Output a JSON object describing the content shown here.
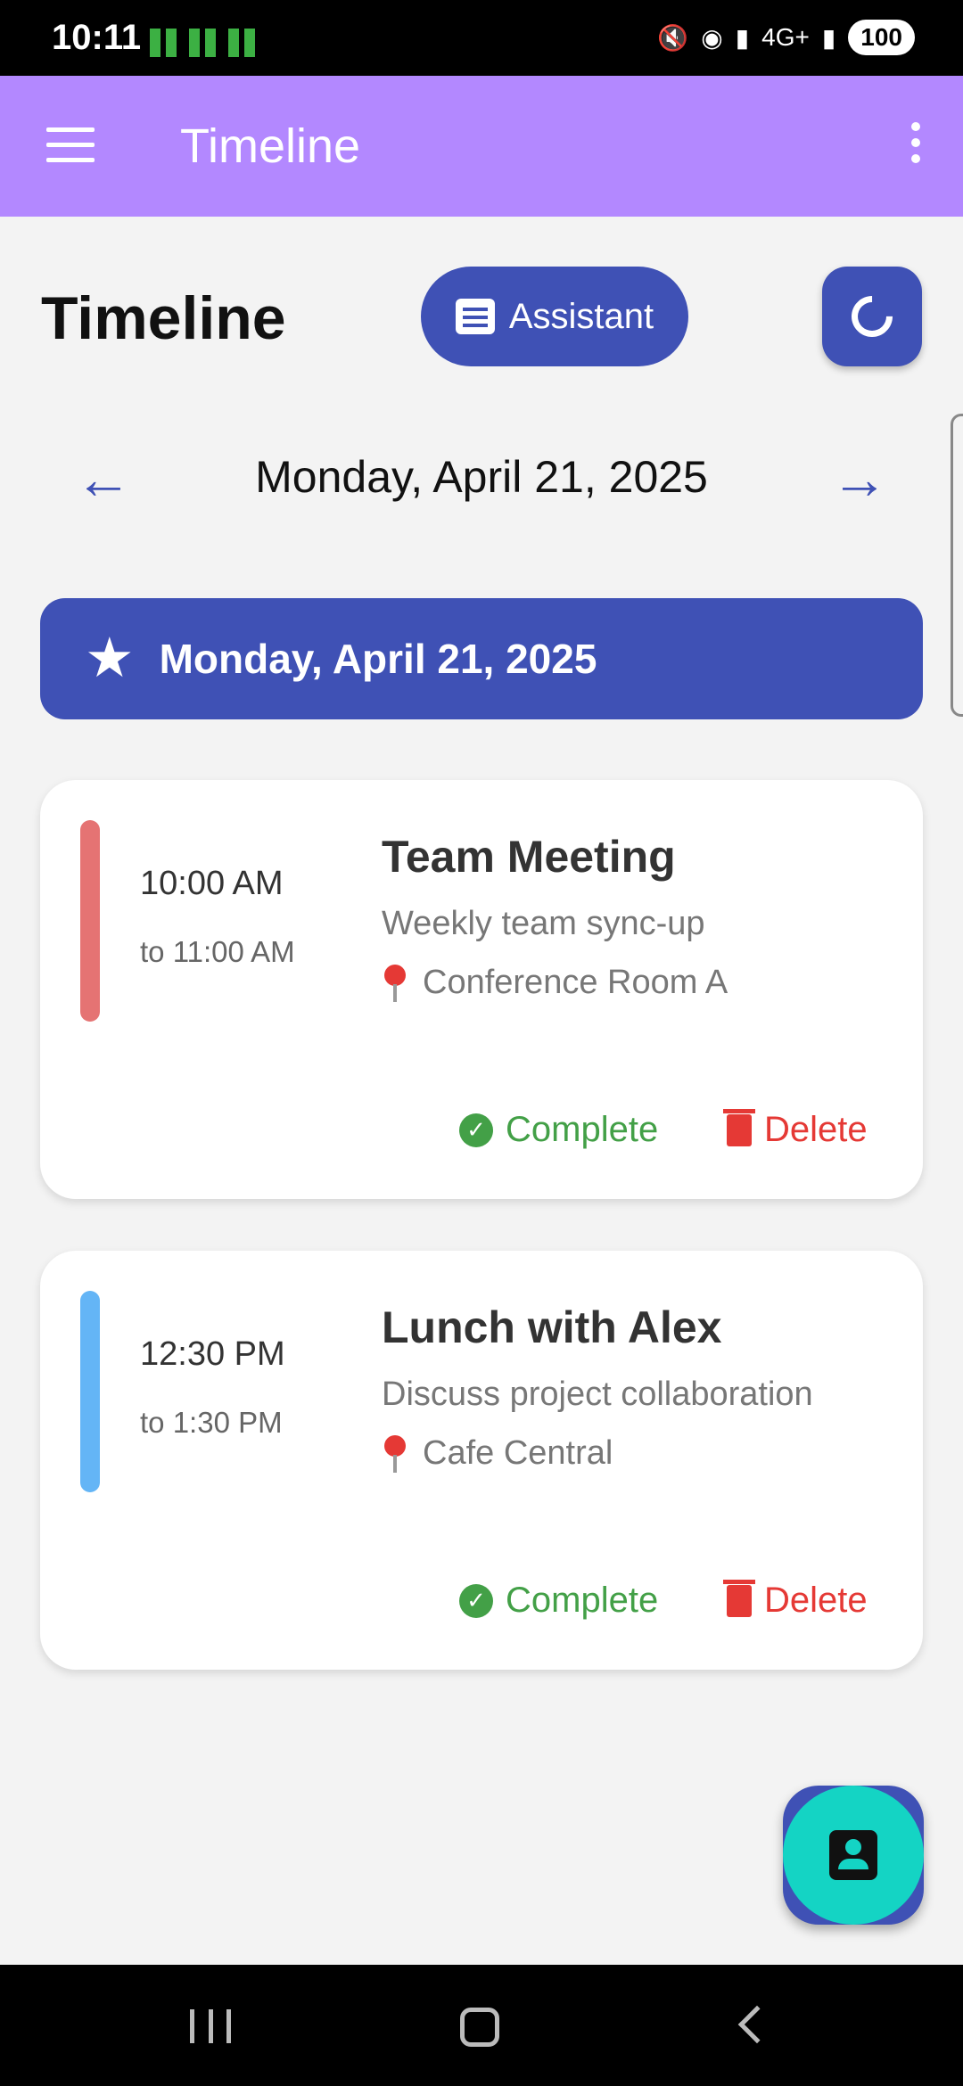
{
  "status_bar": {
    "time": "10:11",
    "signal": "4G+",
    "battery": "100"
  },
  "app_bar": {
    "title": "Timeline"
  },
  "header": {
    "title": "Timeline",
    "assistant_label": "Assistant"
  },
  "date_nav": {
    "date": "Monday, April 21, 2025"
  },
  "day_header": {
    "label": "Monday, April 21, 2025"
  },
  "events": [
    {
      "title": "Team Meeting",
      "description": "Weekly team sync-up",
      "location": "Conference Room A",
      "start": "10:00 AM",
      "end": "to 11:00 AM",
      "color": "#e57373",
      "complete_label": "Complete",
      "delete_label": "Delete"
    },
    {
      "title": "Lunch with Alex",
      "description": "Discuss project collaboration",
      "location": "Cafe Central",
      "start": "12:30 PM",
      "end": "to 1:30 PM",
      "color": "#64b5f6",
      "complete_label": "Complete",
      "delete_label": "Delete"
    }
  ],
  "colors": {
    "app_bar": "#b388ff",
    "primary": "#3f51b5",
    "fab": "#14d4c4",
    "complete": "#43a047",
    "delete": "#e53935"
  }
}
